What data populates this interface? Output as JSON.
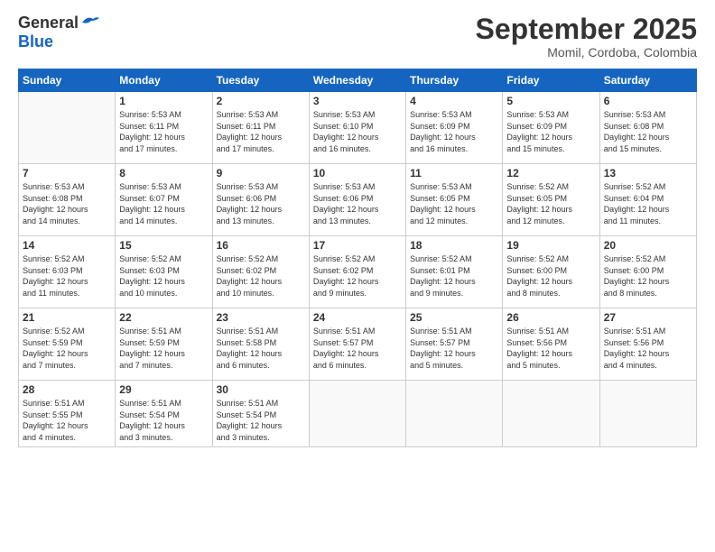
{
  "header": {
    "logo_general": "General",
    "logo_blue": "Blue",
    "month_title": "September 2025",
    "location": "Momil, Cordoba, Colombia"
  },
  "days_of_week": [
    "Sunday",
    "Monday",
    "Tuesday",
    "Wednesday",
    "Thursday",
    "Friday",
    "Saturday"
  ],
  "weeks": [
    [
      {
        "day": "",
        "info": ""
      },
      {
        "day": "1",
        "info": "Sunrise: 5:53 AM\nSunset: 6:11 PM\nDaylight: 12 hours\nand 17 minutes."
      },
      {
        "day": "2",
        "info": "Sunrise: 5:53 AM\nSunset: 6:11 PM\nDaylight: 12 hours\nand 17 minutes."
      },
      {
        "day": "3",
        "info": "Sunrise: 5:53 AM\nSunset: 6:10 PM\nDaylight: 12 hours\nand 16 minutes."
      },
      {
        "day": "4",
        "info": "Sunrise: 5:53 AM\nSunset: 6:09 PM\nDaylight: 12 hours\nand 16 minutes."
      },
      {
        "day": "5",
        "info": "Sunrise: 5:53 AM\nSunset: 6:09 PM\nDaylight: 12 hours\nand 15 minutes."
      },
      {
        "day": "6",
        "info": "Sunrise: 5:53 AM\nSunset: 6:08 PM\nDaylight: 12 hours\nand 15 minutes."
      }
    ],
    [
      {
        "day": "7",
        "info": "Sunrise: 5:53 AM\nSunset: 6:08 PM\nDaylight: 12 hours\nand 14 minutes."
      },
      {
        "day": "8",
        "info": "Sunrise: 5:53 AM\nSunset: 6:07 PM\nDaylight: 12 hours\nand 14 minutes."
      },
      {
        "day": "9",
        "info": "Sunrise: 5:53 AM\nSunset: 6:06 PM\nDaylight: 12 hours\nand 13 minutes."
      },
      {
        "day": "10",
        "info": "Sunrise: 5:53 AM\nSunset: 6:06 PM\nDaylight: 12 hours\nand 13 minutes."
      },
      {
        "day": "11",
        "info": "Sunrise: 5:53 AM\nSunset: 6:05 PM\nDaylight: 12 hours\nand 12 minutes."
      },
      {
        "day": "12",
        "info": "Sunrise: 5:52 AM\nSunset: 6:05 PM\nDaylight: 12 hours\nand 12 minutes."
      },
      {
        "day": "13",
        "info": "Sunrise: 5:52 AM\nSunset: 6:04 PM\nDaylight: 12 hours\nand 11 minutes."
      }
    ],
    [
      {
        "day": "14",
        "info": "Sunrise: 5:52 AM\nSunset: 6:03 PM\nDaylight: 12 hours\nand 11 minutes."
      },
      {
        "day": "15",
        "info": "Sunrise: 5:52 AM\nSunset: 6:03 PM\nDaylight: 12 hours\nand 10 minutes."
      },
      {
        "day": "16",
        "info": "Sunrise: 5:52 AM\nSunset: 6:02 PM\nDaylight: 12 hours\nand 10 minutes."
      },
      {
        "day": "17",
        "info": "Sunrise: 5:52 AM\nSunset: 6:02 PM\nDaylight: 12 hours\nand 9 minutes."
      },
      {
        "day": "18",
        "info": "Sunrise: 5:52 AM\nSunset: 6:01 PM\nDaylight: 12 hours\nand 9 minutes."
      },
      {
        "day": "19",
        "info": "Sunrise: 5:52 AM\nSunset: 6:00 PM\nDaylight: 12 hours\nand 8 minutes."
      },
      {
        "day": "20",
        "info": "Sunrise: 5:52 AM\nSunset: 6:00 PM\nDaylight: 12 hours\nand 8 minutes."
      }
    ],
    [
      {
        "day": "21",
        "info": "Sunrise: 5:52 AM\nSunset: 5:59 PM\nDaylight: 12 hours\nand 7 minutes."
      },
      {
        "day": "22",
        "info": "Sunrise: 5:51 AM\nSunset: 5:59 PM\nDaylight: 12 hours\nand 7 minutes."
      },
      {
        "day": "23",
        "info": "Sunrise: 5:51 AM\nSunset: 5:58 PM\nDaylight: 12 hours\nand 6 minutes."
      },
      {
        "day": "24",
        "info": "Sunrise: 5:51 AM\nSunset: 5:57 PM\nDaylight: 12 hours\nand 6 minutes."
      },
      {
        "day": "25",
        "info": "Sunrise: 5:51 AM\nSunset: 5:57 PM\nDaylight: 12 hours\nand 5 minutes."
      },
      {
        "day": "26",
        "info": "Sunrise: 5:51 AM\nSunset: 5:56 PM\nDaylight: 12 hours\nand 5 minutes."
      },
      {
        "day": "27",
        "info": "Sunrise: 5:51 AM\nSunset: 5:56 PM\nDaylight: 12 hours\nand 4 minutes."
      }
    ],
    [
      {
        "day": "28",
        "info": "Sunrise: 5:51 AM\nSunset: 5:55 PM\nDaylight: 12 hours\nand 4 minutes."
      },
      {
        "day": "29",
        "info": "Sunrise: 5:51 AM\nSunset: 5:54 PM\nDaylight: 12 hours\nand 3 minutes."
      },
      {
        "day": "30",
        "info": "Sunrise: 5:51 AM\nSunset: 5:54 PM\nDaylight: 12 hours\nand 3 minutes."
      },
      {
        "day": "",
        "info": ""
      },
      {
        "day": "",
        "info": ""
      },
      {
        "day": "",
        "info": ""
      },
      {
        "day": "",
        "info": ""
      }
    ]
  ]
}
